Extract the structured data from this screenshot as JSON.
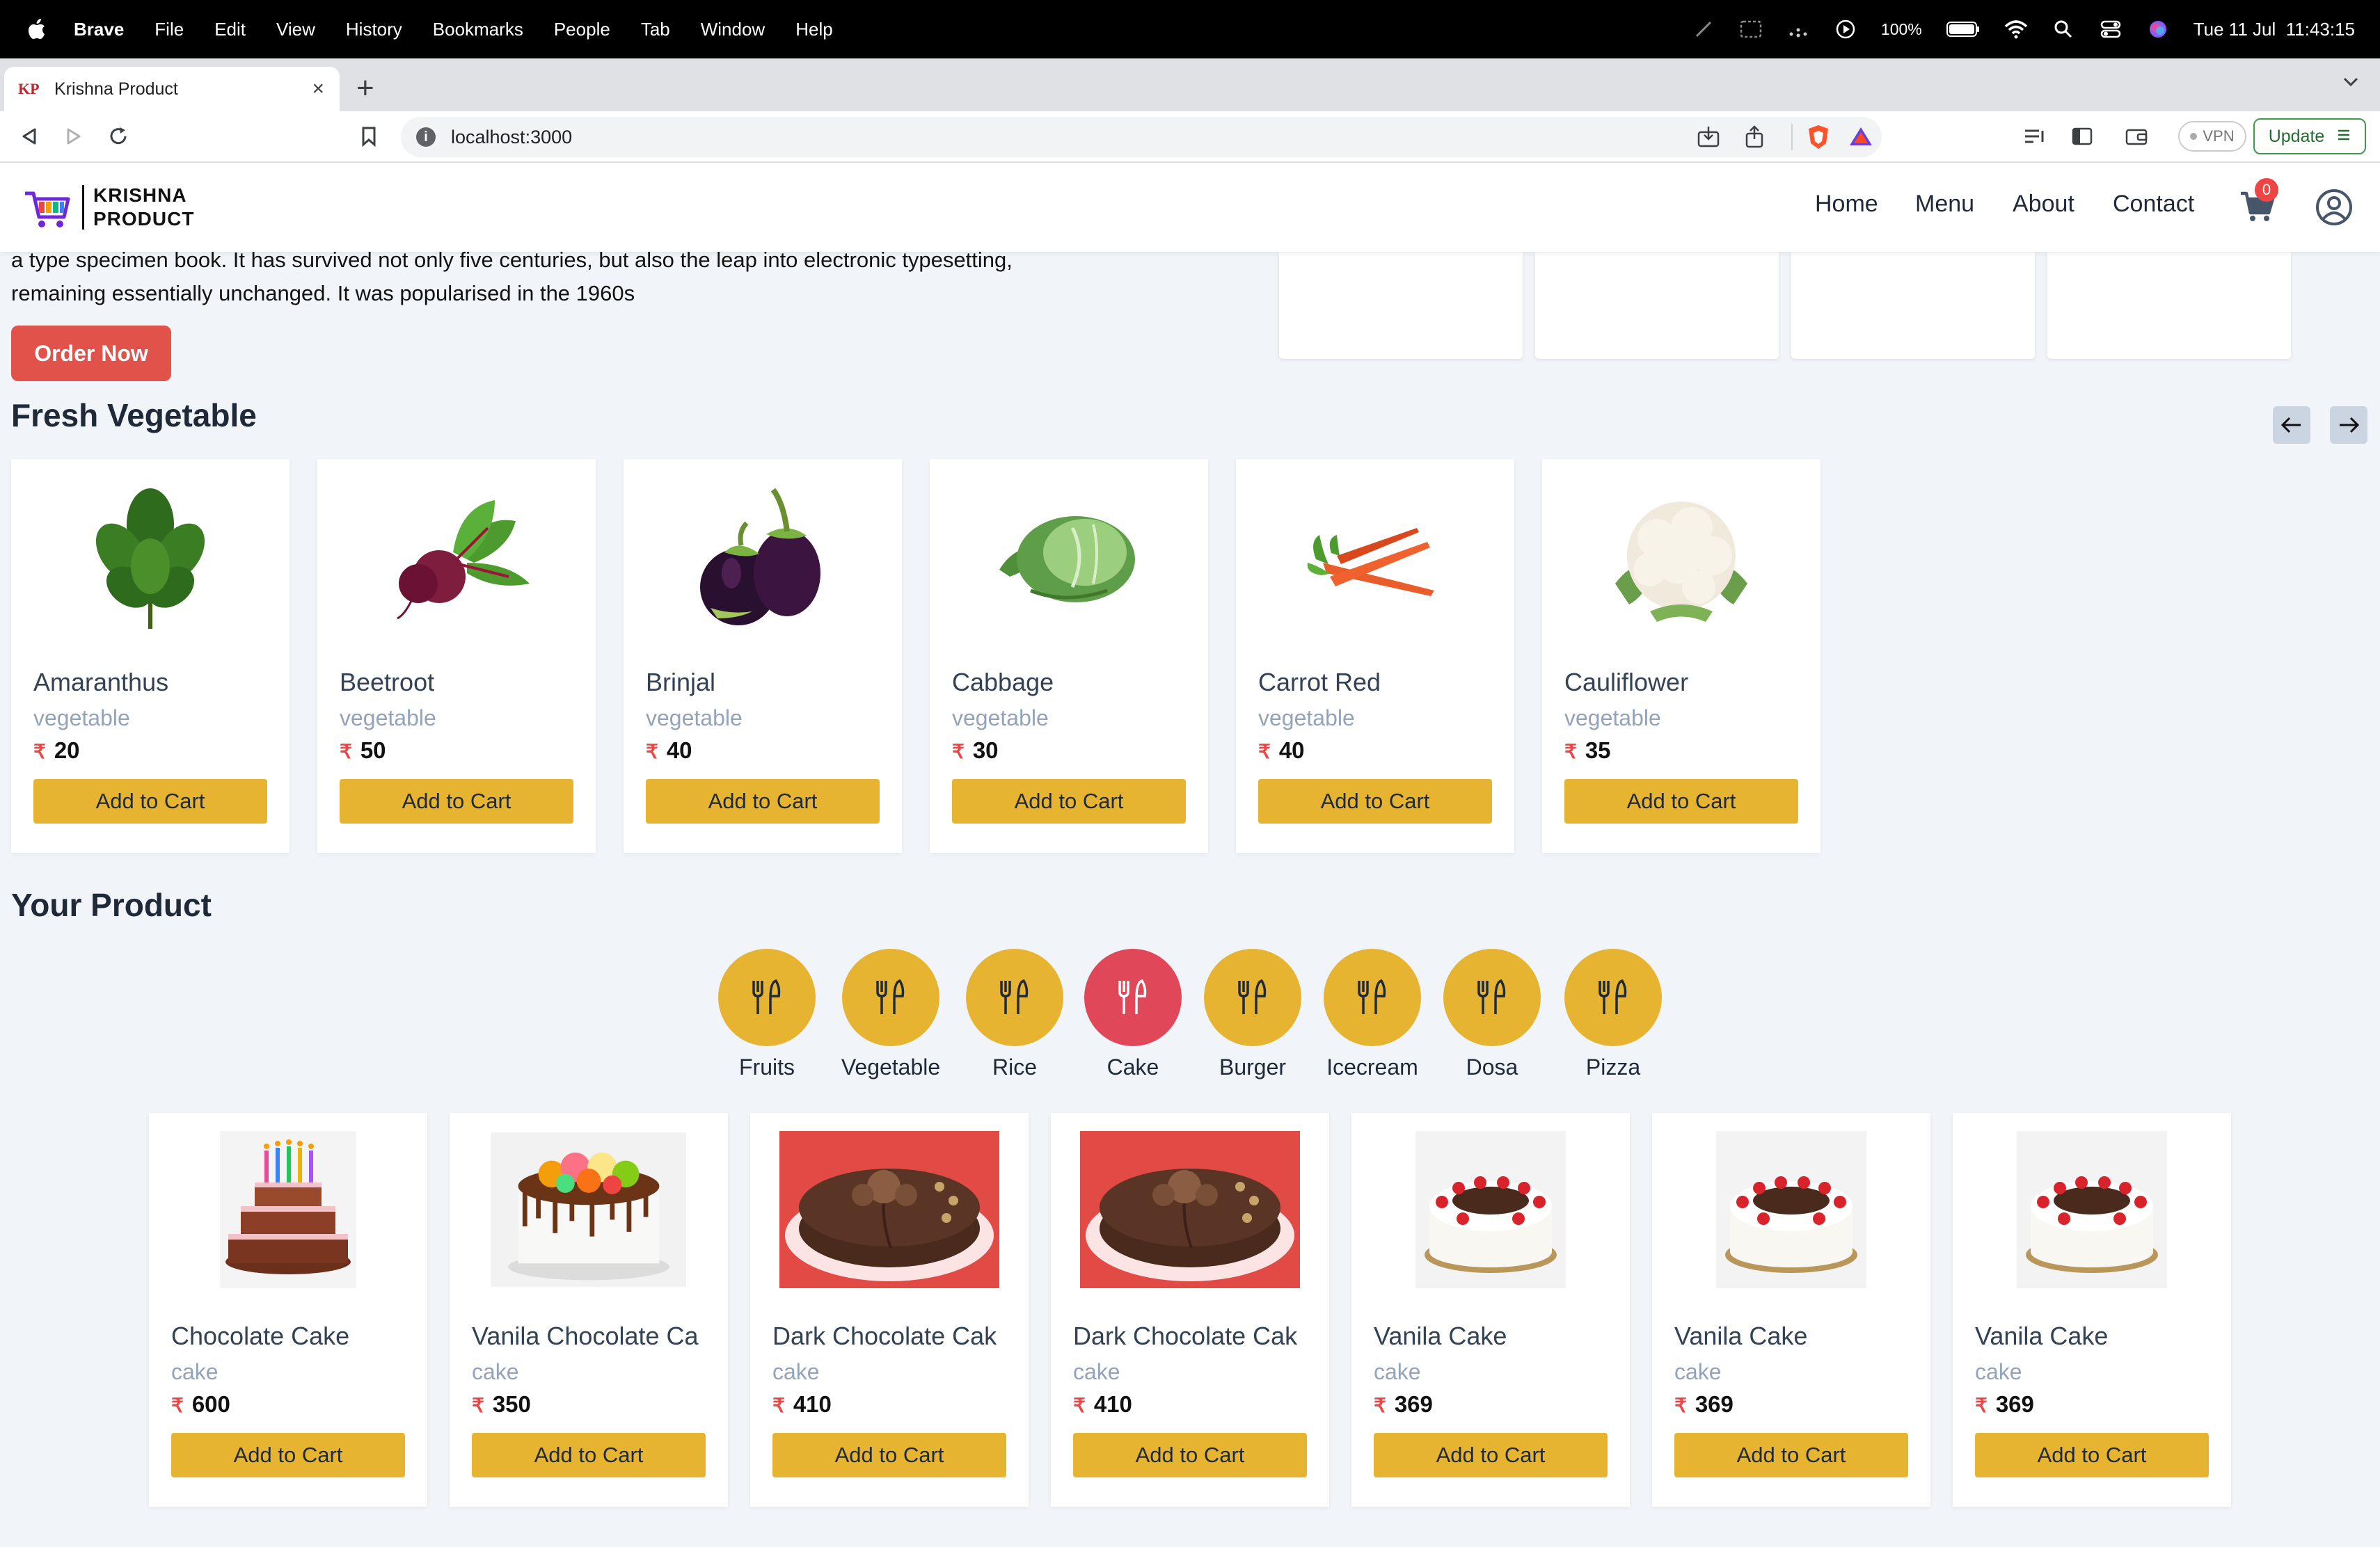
{
  "menubar": {
    "app": "Brave",
    "items": [
      "File",
      "Edit",
      "View",
      "History",
      "Bookmarks",
      "People",
      "Tab",
      "Window",
      "Help"
    ],
    "battery": "100%",
    "datetime": "Tue 11 Jul  11:43:15"
  },
  "browser": {
    "tab_title": "Krishna Product",
    "tab_favicon": "KP",
    "url": "localhost:3000",
    "vpn_label": "VPN",
    "update_label": "Update"
  },
  "site": {
    "brand_line1": "KRISHNA",
    "brand_line2": "PRODUCT",
    "nav": [
      "Home",
      "Menu",
      "About",
      "Contact"
    ],
    "cart_count": "0"
  },
  "hero": {
    "text": "a type specimen book. It has survived not only five centuries, but also the leap into electronic typesetting, remaining essentially unchanged. It was popularised in the 1960s",
    "order_button": "Order Now"
  },
  "fresh": {
    "title": "Fresh Vegetable",
    "items": [
      {
        "name": "Amaranthus",
        "category": "vegetable",
        "price": "20",
        "image": "amaranthus-image"
      },
      {
        "name": "Beetroot",
        "category": "vegetable",
        "price": "50",
        "image": "beetroot-image"
      },
      {
        "name": "Brinjal",
        "category": "vegetable",
        "price": "40",
        "image": "brinjal-image"
      },
      {
        "name": "Cabbage",
        "category": "vegetable",
        "price": "30",
        "image": "cabbage-image"
      },
      {
        "name": "Carrot Red",
        "category": "vegetable",
        "price": "40",
        "image": "carrot-image"
      },
      {
        "name": "Cauliflower",
        "category": "vegetable",
        "price": "35",
        "image": "cauliflower-image"
      }
    ]
  },
  "your_product": {
    "title": "Your Product",
    "categories": [
      "Fruits",
      "Vegetable",
      "Rice",
      "Cake",
      "Burger",
      "Icecream",
      "Dosa",
      "Pizza"
    ],
    "active_category": "Cake",
    "items": [
      {
        "name": "Chocolate Cake",
        "category": "cake",
        "price": "600",
        "image": "birthday-cake-image"
      },
      {
        "name": "Vanila Chocolate Ca",
        "category": "cake",
        "price": "350",
        "image": "drip-cake-image"
      },
      {
        "name": "Dark Chocolate Cak",
        "category": "cake",
        "price": "410",
        "image": "dark-chocolate-cake-image"
      },
      {
        "name": "Dark Chocolate Cak",
        "category": "cake",
        "price": "410",
        "image": "dark-chocolate-cake-image"
      },
      {
        "name": "Vanila Cake",
        "category": "cake",
        "price": "369",
        "image": "vanilla-cake-image"
      },
      {
        "name": "Vanila Cake",
        "category": "cake",
        "price": "369",
        "image": "vanilla-cake-image"
      },
      {
        "name": "Vanila Cake",
        "category": "cake",
        "price": "369",
        "image": "vanilla-cake-image"
      }
    ]
  },
  "labels": {
    "add_to_cart": "Add to Cart",
    "rupee": "₹"
  },
  "colors": {
    "accent_yellow": "#e6b431",
    "accent_red": "#e0524a",
    "category_active": "#e0485a",
    "page_bg": "#f1f5f9"
  }
}
